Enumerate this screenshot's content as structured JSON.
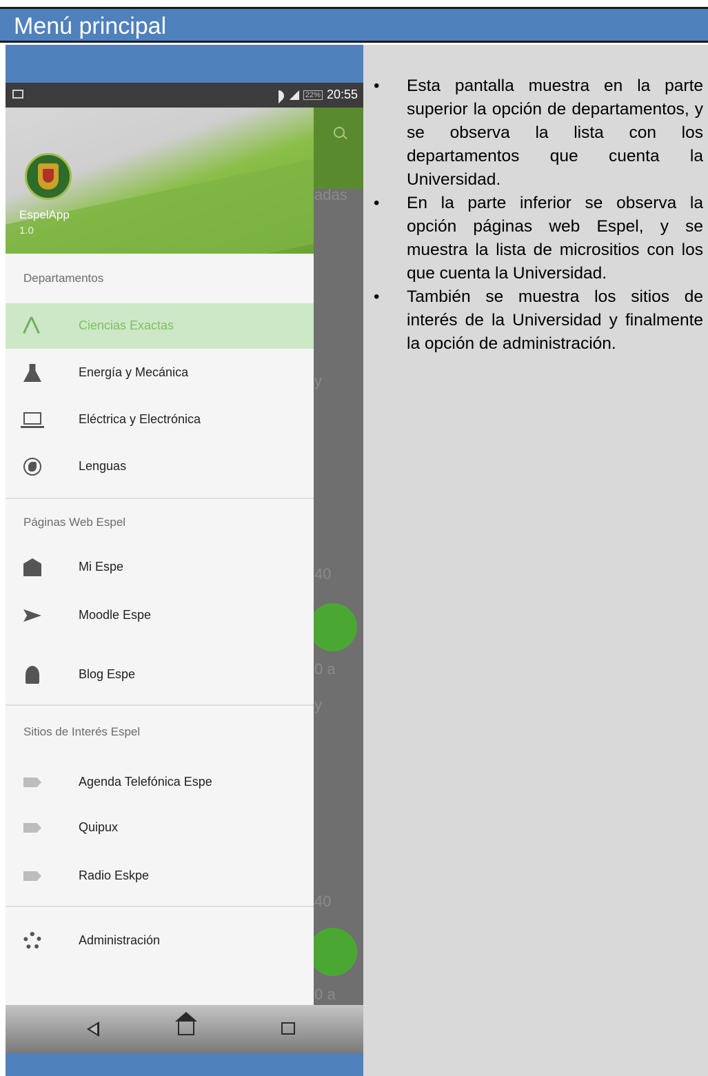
{
  "document": {
    "title": "Menú principal",
    "bullets": [
      "Esta pantalla muestra en la parte superior la opción de departamentos, y se observa la lista con los departamentos que cuenta la Universidad.",
      "En la parte inferior se observa la opción páginas web Espel, y se muestra la lista de micrositios con los que cuenta la Universidad.",
      "También se muestra los sitios de interés de la Universidad y finalmente la opción de administración."
    ]
  },
  "phone": {
    "status_time": "20:55",
    "battery": "22%",
    "app_name": "EspelApp",
    "app_version": "1.0",
    "background_text": [
      "adas",
      "y",
      "40",
      "0 a",
      "y",
      "40",
      "0 a"
    ],
    "accent_color": "#6db25a",
    "sections": [
      {
        "title": "Departamentos",
        "items": [
          {
            "label": "Ciencias Exactas",
            "icon": "compass-icon",
            "active": true
          },
          {
            "label": "Energía y Mecánica",
            "icon": "flask-icon"
          },
          {
            "label": "Eléctrica y Electrónica",
            "icon": "laptop-icon"
          },
          {
            "label": "Lenguas",
            "icon": "globe-icon"
          }
        ]
      },
      {
        "title": "Páginas Web Espel",
        "items": [
          {
            "label": "Mi Espe",
            "icon": "mail-icon"
          },
          {
            "label": "Moodle Espe",
            "icon": "send-icon"
          },
          {
            "label": "Blog Espe",
            "icon": "bell-icon"
          }
        ]
      },
      {
        "title": "Sitios de Interés Espel",
        "items": [
          {
            "label": "Agenda Telefónica Espe",
            "icon": "label-icon"
          },
          {
            "label": "Quipux",
            "icon": "label-icon"
          },
          {
            "label": "Radio Eskpe",
            "icon": "label-icon"
          }
        ]
      },
      {
        "title": "",
        "items": [
          {
            "label": "Administración",
            "icon": "gear-icon"
          }
        ]
      }
    ]
  }
}
